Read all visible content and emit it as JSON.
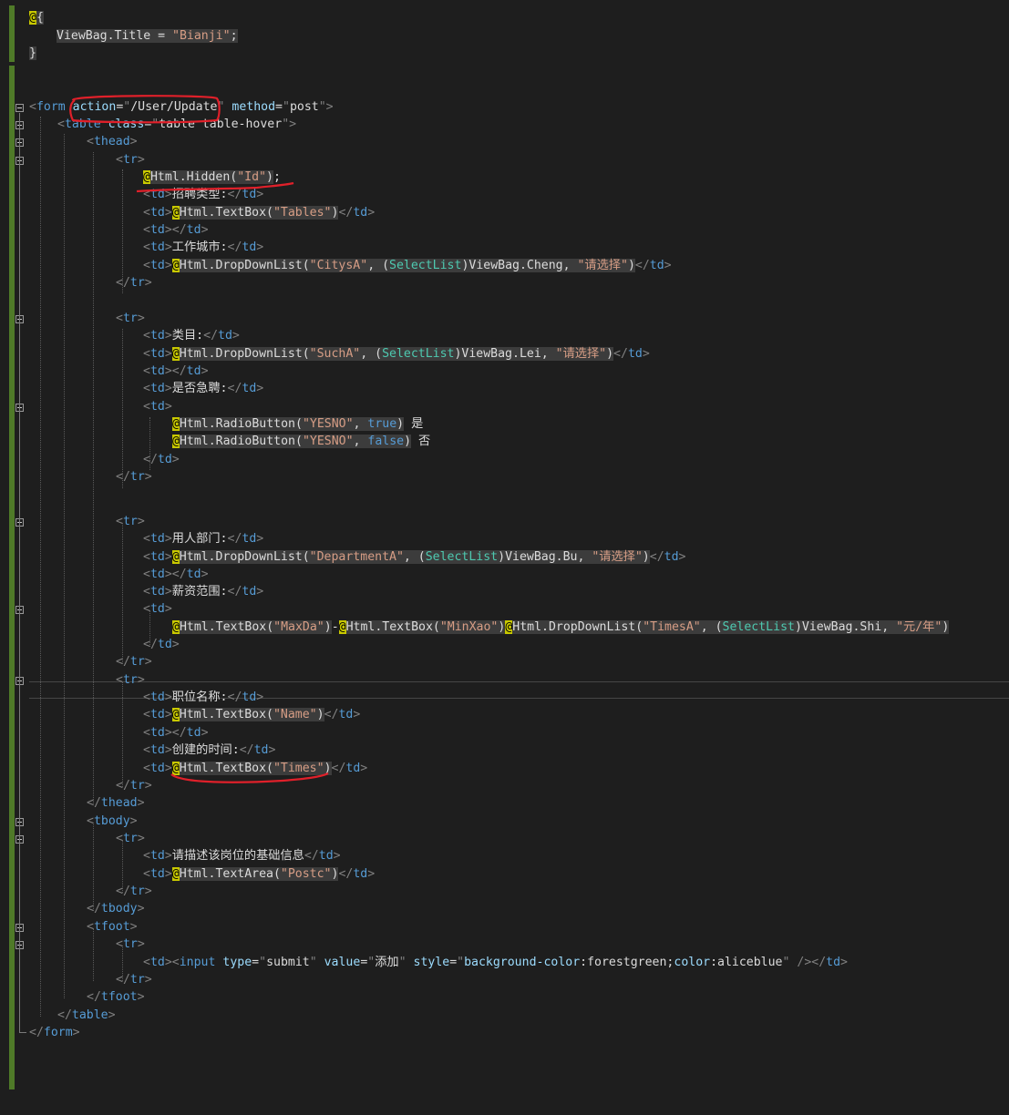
{
  "code_lines": [
    [
      [
        "at",
        "@"
      ],
      [
        "r tx",
        "{"
      ]
    ],
    [
      [
        "r tx",
        "ViewBag.Title = "
      ],
      [
        "r s",
        "\"Bianji\""
      ],
      [
        "r tx",
        ";"
      ]
    ],
    [
      [
        "r tx",
        "}"
      ]
    ],
    [],
    [],
    [
      [
        "p",
        "<"
      ],
      [
        "t",
        "form"
      ],
      [
        "tx",
        " "
      ],
      [
        "a",
        "action"
      ],
      [
        "tx",
        "="
      ],
      [
        "p",
        "\""
      ],
      [
        "tx",
        "/User/Update"
      ],
      [
        "p",
        "\""
      ],
      [
        "tx",
        " "
      ],
      [
        "a",
        "method"
      ],
      [
        "tx",
        "="
      ],
      [
        "p",
        "\""
      ],
      [
        "tx",
        "post"
      ],
      [
        "p",
        "\""
      ],
      [
        "p",
        ">"
      ]
    ],
    [
      [
        "p",
        "<"
      ],
      [
        "t",
        "table"
      ],
      [
        "tx",
        " "
      ],
      [
        "a",
        "class"
      ],
      [
        "tx",
        "="
      ],
      [
        "p",
        "\""
      ],
      [
        "tx",
        "table table-hover"
      ],
      [
        "p",
        "\""
      ],
      [
        "p",
        ">"
      ]
    ],
    [
      [
        "p",
        "<"
      ],
      [
        "t",
        "thead"
      ],
      [
        "p",
        ">"
      ]
    ],
    [
      [
        "p",
        "<"
      ],
      [
        "t",
        "tr"
      ],
      [
        "p",
        ">"
      ]
    ],
    [
      [
        "at",
        "@"
      ],
      [
        "r tx",
        "Html.Hidden("
      ],
      [
        "r s",
        "\"Id\""
      ],
      [
        "r tx",
        ")"
      ],
      [
        "tx",
        ";"
      ]
    ],
    [
      [
        "p",
        "<"
      ],
      [
        "t",
        "td"
      ],
      [
        "p",
        ">"
      ],
      [
        "tx",
        "招聘类型:"
      ],
      [
        "p",
        "</"
      ],
      [
        "t",
        "td"
      ],
      [
        "p",
        ">"
      ]
    ],
    [
      [
        "p",
        "<"
      ],
      [
        "t",
        "td"
      ],
      [
        "p",
        ">"
      ],
      [
        "at",
        "@"
      ],
      [
        "r tx",
        "Html.TextBox("
      ],
      [
        "r s",
        "\"Tables\""
      ],
      [
        "r tx",
        ")"
      ],
      [
        "p",
        "</"
      ],
      [
        "t",
        "td"
      ],
      [
        "p",
        ">"
      ]
    ],
    [
      [
        "p",
        "<"
      ],
      [
        "t",
        "td"
      ],
      [
        "p",
        "></"
      ],
      [
        "t",
        "td"
      ],
      [
        "p",
        ">"
      ]
    ],
    [
      [
        "p",
        "<"
      ],
      [
        "t",
        "td"
      ],
      [
        "p",
        ">"
      ],
      [
        "tx",
        "工作城市:"
      ],
      [
        "p",
        "</"
      ],
      [
        "t",
        "td"
      ],
      [
        "p",
        ">"
      ]
    ],
    [
      [
        "p",
        "<"
      ],
      [
        "t",
        "td"
      ],
      [
        "p",
        ">"
      ],
      [
        "at",
        "@"
      ],
      [
        "r tx",
        "Html.DropDownList("
      ],
      [
        "r s",
        "\"CitysA\""
      ],
      [
        "r tx",
        ", ("
      ],
      [
        "r ty",
        "SelectList"
      ],
      [
        "r tx",
        ")ViewBag.Cheng, "
      ],
      [
        "r s",
        "\"请选择\""
      ],
      [
        "r tx",
        ")"
      ],
      [
        "p",
        "</"
      ],
      [
        "t",
        "td"
      ],
      [
        "p",
        ">"
      ]
    ],
    [
      [
        "p",
        "</"
      ],
      [
        "t",
        "tr"
      ],
      [
        "p",
        ">"
      ]
    ],
    [],
    [
      [
        "p",
        "<"
      ],
      [
        "t",
        "tr"
      ],
      [
        "p",
        ">"
      ]
    ],
    [
      [
        "p",
        "<"
      ],
      [
        "t",
        "td"
      ],
      [
        "p",
        ">"
      ],
      [
        "tx",
        "类目:"
      ],
      [
        "p",
        "</"
      ],
      [
        "t",
        "td"
      ],
      [
        "p",
        ">"
      ]
    ],
    [
      [
        "p",
        "<"
      ],
      [
        "t",
        "td"
      ],
      [
        "p",
        ">"
      ],
      [
        "at",
        "@"
      ],
      [
        "r tx",
        "Html.DropDownList("
      ],
      [
        "r s",
        "\"SuchA\""
      ],
      [
        "r tx",
        ", ("
      ],
      [
        "r ty",
        "SelectList"
      ],
      [
        "r tx",
        ")ViewBag.Lei, "
      ],
      [
        "r s",
        "\"请选择\""
      ],
      [
        "r tx",
        ")"
      ],
      [
        "p",
        "</"
      ],
      [
        "t",
        "td"
      ],
      [
        "p",
        ">"
      ]
    ],
    [
      [
        "p",
        "<"
      ],
      [
        "t",
        "td"
      ],
      [
        "p",
        "></"
      ],
      [
        "t",
        "td"
      ],
      [
        "p",
        ">"
      ]
    ],
    [
      [
        "p",
        "<"
      ],
      [
        "t",
        "td"
      ],
      [
        "p",
        ">"
      ],
      [
        "tx",
        "是否急聘:"
      ],
      [
        "p",
        "</"
      ],
      [
        "t",
        "td"
      ],
      [
        "p",
        ">"
      ]
    ],
    [
      [
        "p",
        "<"
      ],
      [
        "t",
        "td"
      ],
      [
        "p",
        ">"
      ]
    ],
    [
      [
        "at",
        "@"
      ],
      [
        "r tx",
        "Html.RadioButton("
      ],
      [
        "r s",
        "\"YESNO\""
      ],
      [
        "r tx",
        ", "
      ],
      [
        "r k",
        "true"
      ],
      [
        "r tx",
        ")"
      ],
      [
        "tx",
        " 是"
      ]
    ],
    [
      [
        "at",
        "@"
      ],
      [
        "r tx",
        "Html.RadioButton("
      ],
      [
        "r s",
        "\"YESNO\""
      ],
      [
        "r tx",
        ", "
      ],
      [
        "r k",
        "false"
      ],
      [
        "r tx",
        ")"
      ],
      [
        "tx",
        " 否"
      ]
    ],
    [
      [
        "p",
        "</"
      ],
      [
        "t",
        "td"
      ],
      [
        "p",
        ">"
      ]
    ],
    [
      [
        "p",
        "</"
      ],
      [
        "t",
        "tr"
      ],
      [
        "p",
        ">"
      ]
    ],
    [],
    [
      [
        "p",
        "<"
      ],
      [
        "t",
        "tr"
      ],
      [
        "p",
        ">"
      ]
    ],
    [
      [
        "p",
        "<"
      ],
      [
        "t",
        "td"
      ],
      [
        "p",
        ">"
      ],
      [
        "tx",
        "用人部门:"
      ],
      [
        "p",
        "</"
      ],
      [
        "t",
        "td"
      ],
      [
        "p",
        ">"
      ]
    ],
    [
      [
        "p",
        "<"
      ],
      [
        "t",
        "td"
      ],
      [
        "p",
        ">"
      ],
      [
        "at",
        "@"
      ],
      [
        "r tx",
        "Html.DropDownList("
      ],
      [
        "r s",
        "\"DepartmentA\""
      ],
      [
        "r tx",
        ", ("
      ],
      [
        "r ty",
        "SelectList"
      ],
      [
        "r tx",
        ")ViewBag.Bu, "
      ],
      [
        "r s",
        "\"请选择\""
      ],
      [
        "r tx",
        ")"
      ],
      [
        "p",
        "</"
      ],
      [
        "t",
        "td"
      ],
      [
        "p",
        ">"
      ]
    ],
    [
      [
        "p",
        "<"
      ],
      [
        "t",
        "td"
      ],
      [
        "p",
        "></"
      ],
      [
        "t",
        "td"
      ],
      [
        "p",
        ">"
      ]
    ],
    [
      [
        "p",
        "<"
      ],
      [
        "t",
        "td"
      ],
      [
        "p",
        ">"
      ],
      [
        "tx",
        "薪资范围:"
      ],
      [
        "p",
        "</"
      ],
      [
        "t",
        "td"
      ],
      [
        "p",
        ">"
      ]
    ],
    [
      [
        "p",
        "<"
      ],
      [
        "t",
        "td"
      ],
      [
        "p",
        ">"
      ]
    ],
    [
      [
        "at",
        "@"
      ],
      [
        "r tx",
        "Html.TextBox("
      ],
      [
        "r s",
        "\"MaxDa\""
      ],
      [
        "r tx",
        ")"
      ],
      [
        "tx",
        "-"
      ],
      [
        "at",
        "@"
      ],
      [
        "r tx",
        "Html.TextBox("
      ],
      [
        "r s",
        "\"MinXao\""
      ],
      [
        "r tx",
        ")"
      ],
      [
        "at",
        "@"
      ],
      [
        "r tx",
        "Html.DropDownList("
      ],
      [
        "r s",
        "\"TimesA\""
      ],
      [
        "r tx",
        ", ("
      ],
      [
        "r ty",
        "SelectList"
      ],
      [
        "r tx",
        ")ViewBag.Shi, "
      ],
      [
        "r s",
        "\"元/年\""
      ],
      [
        "r tx",
        ")"
      ]
    ],
    [
      [
        "p",
        "</"
      ],
      [
        "t",
        "td"
      ],
      [
        "p",
        ">"
      ]
    ],
    [
      [
        "p",
        "</"
      ],
      [
        "t",
        "tr"
      ],
      [
        "p",
        ">"
      ]
    ],
    [
      [
        "p",
        "<"
      ],
      [
        "t",
        "tr"
      ],
      [
        "p",
        ">"
      ]
    ],
    [
      [
        "p",
        "<"
      ],
      [
        "t",
        "td"
      ],
      [
        "p",
        ">"
      ],
      [
        "tx",
        "职位名称:"
      ],
      [
        "p",
        "</"
      ],
      [
        "t",
        "td"
      ],
      [
        "p",
        ">"
      ]
    ],
    [
      [
        "p",
        "<"
      ],
      [
        "t",
        "td"
      ],
      [
        "p",
        ">"
      ],
      [
        "at",
        "@"
      ],
      [
        "r tx",
        "Html.TextBox("
      ],
      [
        "r s",
        "\"Name\""
      ],
      [
        "r tx",
        ")"
      ],
      [
        "p",
        "</"
      ],
      [
        "t",
        "td"
      ],
      [
        "p",
        ">"
      ]
    ],
    [
      [
        "p",
        "<"
      ],
      [
        "t",
        "td"
      ],
      [
        "p",
        "></"
      ],
      [
        "t",
        "td"
      ],
      [
        "p",
        ">"
      ]
    ],
    [
      [
        "p",
        "<"
      ],
      [
        "t",
        "td"
      ],
      [
        "p",
        ">"
      ],
      [
        "tx",
        "创建的时间:"
      ],
      [
        "p",
        "</"
      ],
      [
        "t",
        "td"
      ],
      [
        "p",
        ">"
      ]
    ],
    [
      [
        "p",
        "<"
      ],
      [
        "t",
        "td"
      ],
      [
        "p",
        ">"
      ],
      [
        "at",
        "@"
      ],
      [
        "r tx",
        "Html.TextBox("
      ],
      [
        "r s",
        "\"Times\""
      ],
      [
        "r tx",
        ")"
      ],
      [
        "p",
        "</"
      ],
      [
        "t",
        "td"
      ],
      [
        "p",
        ">"
      ]
    ],
    [
      [
        "p",
        "</"
      ],
      [
        "t",
        "tr"
      ],
      [
        "p",
        ">"
      ]
    ],
    [
      [
        "p",
        "</"
      ],
      [
        "t",
        "thead"
      ],
      [
        "p",
        ">"
      ]
    ],
    [
      [
        "p",
        "<"
      ],
      [
        "t",
        "tbody"
      ],
      [
        "p",
        ">"
      ]
    ],
    [
      [
        "p",
        "<"
      ],
      [
        "t",
        "tr"
      ],
      [
        "p",
        ">"
      ]
    ],
    [
      [
        "p",
        "<"
      ],
      [
        "t",
        "td"
      ],
      [
        "p",
        ">"
      ],
      [
        "tx",
        "请描述该岗位的基础信息"
      ],
      [
        "p",
        "</"
      ],
      [
        "t",
        "td"
      ],
      [
        "p",
        ">"
      ]
    ],
    [
      [
        "p",
        "<"
      ],
      [
        "t",
        "td"
      ],
      [
        "p",
        ">"
      ],
      [
        "at",
        "@"
      ],
      [
        "r tx",
        "Html.TextArea("
      ],
      [
        "r s",
        "\"Postc\""
      ],
      [
        "r tx",
        ")"
      ],
      [
        "p",
        "</"
      ],
      [
        "t",
        "td"
      ],
      [
        "p",
        ">"
      ]
    ],
    [
      [
        "p",
        "</"
      ],
      [
        "t",
        "tr"
      ],
      [
        "p",
        ">"
      ]
    ],
    [
      [
        "p",
        "</"
      ],
      [
        "t",
        "tbody"
      ],
      [
        "p",
        ">"
      ]
    ],
    [
      [
        "p",
        "<"
      ],
      [
        "t",
        "tfoot"
      ],
      [
        "p",
        ">"
      ]
    ],
    [
      [
        "p",
        "<"
      ],
      [
        "t",
        "tr"
      ],
      [
        "p",
        ">"
      ]
    ],
    [
      [
        "p",
        "<"
      ],
      [
        "t",
        "td"
      ],
      [
        "p",
        "><"
      ],
      [
        "t",
        "input"
      ],
      [
        "tx",
        " "
      ],
      [
        "a",
        "type"
      ],
      [
        "tx",
        "="
      ],
      [
        "p",
        "\""
      ],
      [
        "tx",
        "submit"
      ],
      [
        "p",
        "\""
      ],
      [
        "tx",
        " "
      ],
      [
        "a",
        "value"
      ],
      [
        "tx",
        "="
      ],
      [
        "p",
        "\""
      ],
      [
        "tx",
        "添加"
      ],
      [
        "p",
        "\""
      ],
      [
        "tx",
        " "
      ],
      [
        "a",
        "style"
      ],
      [
        "tx",
        "="
      ],
      [
        "p",
        "\""
      ],
      [
        "a",
        "background-color"
      ],
      [
        "tx",
        ":forestgreen;"
      ],
      [
        "a",
        "color"
      ],
      [
        "tx",
        ":aliceblue"
      ],
      [
        "p",
        "\""
      ],
      [
        "tx",
        " "
      ],
      [
        "p",
        "/></"
      ],
      [
        "t",
        "td"
      ],
      [
        "p",
        ">"
      ]
    ],
    [
      [
        "p",
        "</"
      ],
      [
        "t",
        "tr"
      ],
      [
        "p",
        ">"
      ]
    ],
    [
      [
        "p",
        "</"
      ],
      [
        "t",
        "tfoot"
      ],
      [
        "p",
        ">"
      ]
    ],
    [
      [
        "p",
        "</"
      ],
      [
        "t",
        "table"
      ],
      [
        "p",
        ">"
      ]
    ],
    [
      [
        "p",
        "</"
      ],
      [
        "t",
        "form"
      ],
      [
        "p",
        ">"
      ]
    ]
  ],
  "colors": {
    "background": "#1e1e1e",
    "tag": "#569cd6",
    "attribute": "#9cdcfe",
    "string": "#d69d85",
    "punctuation": "#808080",
    "type": "#4ec9b0",
    "razor_marker": "#c8c800",
    "change_bar": "#4f7a28",
    "annotation": "#e0202a"
  }
}
